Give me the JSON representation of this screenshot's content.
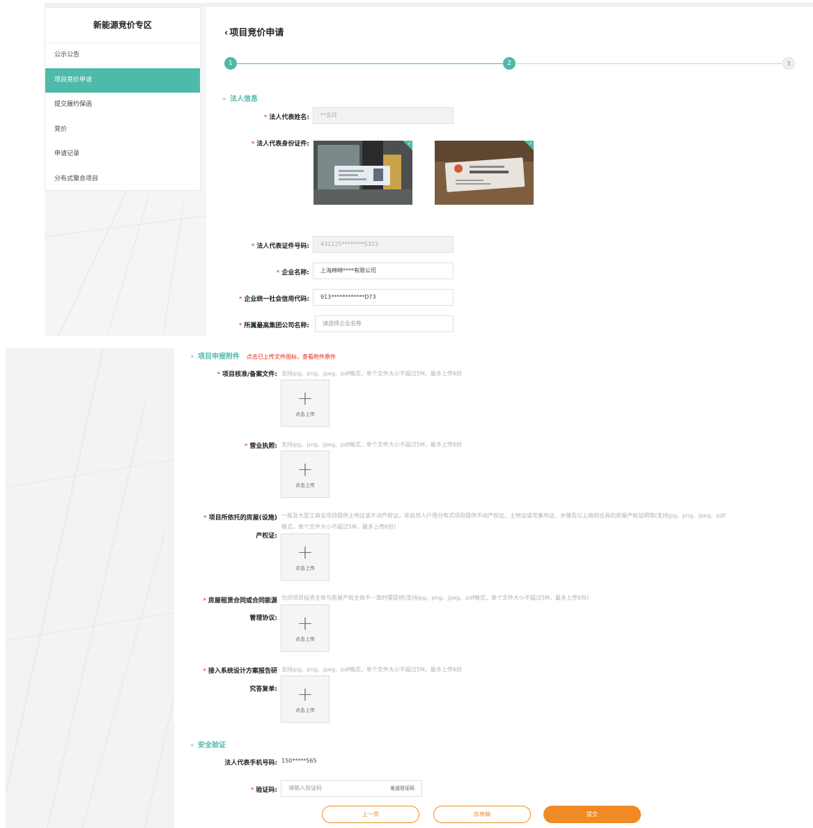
{
  "sidebar": {
    "title": "新能源竞价专区",
    "items": [
      {
        "label": "公示公告",
        "active": false
      },
      {
        "label": "项目竞价申请",
        "active": true
      },
      {
        "label": "提交履约保函",
        "active": false
      },
      {
        "label": "竞价",
        "active": false
      },
      {
        "label": "申请记录",
        "active": false
      },
      {
        "label": "分布式聚合项目",
        "active": false
      }
    ]
  },
  "page": {
    "title": "项目竞价申请",
    "back_icon": "chevron-left-icon"
  },
  "steps": [
    "1",
    "2",
    "3"
  ],
  "current_step": 2,
  "legal": {
    "section_title": "法人信息",
    "name_label": "法人代表姓名:",
    "name_value": "**东玲",
    "id_card_label": "法人代表身份证件:",
    "id_number_label": "法人代表证件号码:",
    "id_number_value": "431125********5323",
    "company_label": "企业名称:",
    "company_value": "上海绵绵****有限公司",
    "credit_label": "企业统一社会信用代码:",
    "credit_value": "913************D73",
    "group_label": "所属最高集团公司名称:",
    "group_placeholder": "请选择企业名称"
  },
  "attachments": {
    "section_title": "项目申报附件",
    "section_note": "点击已上传文件图标，查看附件原件",
    "upload_label": "点击上传",
    "items": [
      {
        "label": "项目核准/备案文件:",
        "hint": "支持jpg、png、jpeg、pdf格式，单个文件大小不超过5M，最多上传6份"
      },
      {
        "label": "营业执照:",
        "hint": "支持jpg、png、jpeg、pdf格式，单个文件大小不超过5M，最多上传6份"
      },
      {
        "label_line1": "项目所依托的房屋(设施)",
        "label_line2": "产权证:",
        "hint_line1": "一般及大型工商业项目提供土地证或不动产权证，非自然人户用分布式项目提供不动产权证、土地证或宅基地证、乡镇及以上政府出具的房屋产权证明等(支持jpg、png、jpeg、pdf",
        "hint_line2": "格式，单个文件大小不超过5M，最多上传6份)"
      },
      {
        "label_line1": "房屋租赁合同或合同能源",
        "label_line2": "管理协议:",
        "hint": "光伏项目投资主体与房屋产权主体不一致时需提供(支持jpg、png、jpeg、pdf格式，单个文件大小不超过5M，最多上传6份)"
      },
      {
        "label_line1": "接入系统设计方案报告研",
        "label_line2": "究答复单:",
        "hint": "支持jpg、png、jpeg、pdf格式，单个文件大小不超过5M，最多上传6份"
      }
    ]
  },
  "security": {
    "section_title": "安全验证",
    "phone_label": "法人代表手机号码:",
    "phone_value": "150*****565",
    "code_label": "验证码:",
    "code_placeholder": "请输入验证码",
    "send_code": "发送验证码"
  },
  "buttons": {
    "prev": "上一页",
    "draft": "存草稿",
    "submit": "提交"
  },
  "colors": {
    "accent": "#4ebaa9",
    "orange": "#f08a24",
    "required": "#e0261b"
  }
}
